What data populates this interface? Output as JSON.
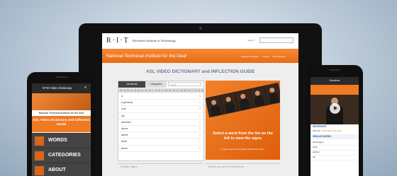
{
  "desktop": {
    "logo": "R·I·T",
    "institute": "Rochester Institute of Technology",
    "search_label": "Search",
    "banner_title": "National Technical Institute for the Deaf",
    "top_nav": [
      "Request Information",
      "Contact",
      "NTID Directory"
    ],
    "dictionary_title": "ASL VIDEO DICTIONARY and INFLECTION GUIDE",
    "tabs": {
      "all_words": "All Words",
      "categories": "Categories"
    },
    "search_placeholder": "Search",
    "alphabet": "# A B C D E F G H I J K L M N O P Q R S T U V W X Y Z",
    "words": [
      {
        "word": "a",
        "n": "3"
      },
      {
        "word": "a (printed)",
        "n": "1"
      },
      {
        "word": "a bit",
        "n": "2"
      },
      {
        "word": "AA",
        "n": "1"
      },
      {
        "word": "abandon",
        "n": "2"
      },
      {
        "word": "above",
        "n": "2"
      },
      {
        "word": "above",
        "n": "1"
      },
      {
        "word": "abort",
        "n": "1"
      },
      {
        "word": "about",
        "n": "3"
      }
    ],
    "select_message": "Select a word from the list on the left to view the signs",
    "select_sub": "or type a word in the search field and hit return.",
    "similar_signs_label": "Similar Signs",
    "words_in_sentences_label": "Words as used in sentences"
  },
  "phone_left": {
    "title": "NTID Video Dictionary",
    "ntid": "National Technical Institute for the Deaf",
    "asl_title": "ASL Video Dictionary and Inflection Guide",
    "menu": [
      "WORDS",
      "CATEGORIES",
      "ABOUT"
    ]
  },
  "phone_right": {
    "title": "Grammar",
    "sentences_label": "SENTENCES",
    "sentence_row": "ADJ 4/2",
    "sentence_tags": "WHQ  ENG  WQ  NEG",
    "similar_words_label": "SIMILAR WORDS",
    "similar_words": [
      "champagne",
      "drink",
      "alcohol",
      "bar"
    ]
  }
}
